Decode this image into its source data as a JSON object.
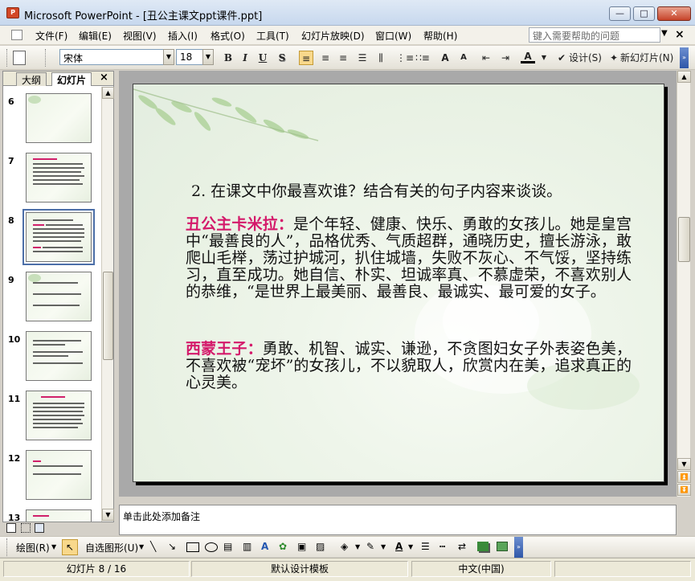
{
  "window": {
    "title": "Microsoft PowerPoint - [丑公主课文ppt课件.ppt]",
    "app_icon": "P",
    "buttons": {
      "minimize": "—",
      "maximize": "□",
      "close": "✕"
    }
  },
  "menu": {
    "items": [
      "文件(F)",
      "编辑(E)",
      "视图(V)",
      "插入(I)",
      "格式(O)",
      "工具(T)",
      "幻灯片放映(D)",
      "窗口(W)",
      "帮助(H)"
    ],
    "help_placeholder": "键入需要帮助的问题",
    "doc_close": "×"
  },
  "toolbar": {
    "font_name": "宋体",
    "font_size": "18",
    "bold": "B",
    "italic": "I",
    "underline": "U",
    "shadow": "S",
    "grow_font": "A",
    "shrink_font": "A",
    "design_label": "设计(S)",
    "new_slide_label": "新幻灯片(N)"
  },
  "left_panel": {
    "tabs": [
      "大纲",
      "幻灯片"
    ],
    "close": "×",
    "thumb_numbers": [
      "6",
      "7",
      "8",
      "9",
      "10",
      "11",
      "12",
      "13"
    ],
    "selected_slide": "8"
  },
  "slide": {
    "question": "2. 在课文中你最喜欢谁？结合有关的句子内容来谈谈。",
    "p1_name": "丑公主卡米拉：",
    "p1_text": "是个年轻、健康、快乐、勇敢的女孩儿。她是皇宫中“最善良的人”，品格优秀、气质超群，通晓历史，擅长游泳，敢爬山毛榉，荡过护城河，扒住城墙，失败不灰心、不气馁，坚持练习，直至成功。她自信、朴实、坦诚率真、不慕虚荣，不喜欢别人的恭维，“是世界上最美丽、最善良、最诚实、最可爱的女子。",
    "p2_name": "西蒙王子：",
    "p2_text": "勇敢、机智、诚实、谦逊，不贪图妇女子外表姿色美，不喜欢被“宠坏”的女孩儿，不以貌取人，欣赏内在美，追求真正的心灵美。",
    "highlight_color": "#d4196a"
  },
  "notes": {
    "placeholder": "单击此处添加备注"
  },
  "draw_toolbar": {
    "draw_label": "绘图(R)",
    "autoshapes_label": "自选图形(U)"
  },
  "status": {
    "slide_info": "幻灯片 8 / 16",
    "template": "默认设计模板",
    "language": "中文(中国)"
  }
}
